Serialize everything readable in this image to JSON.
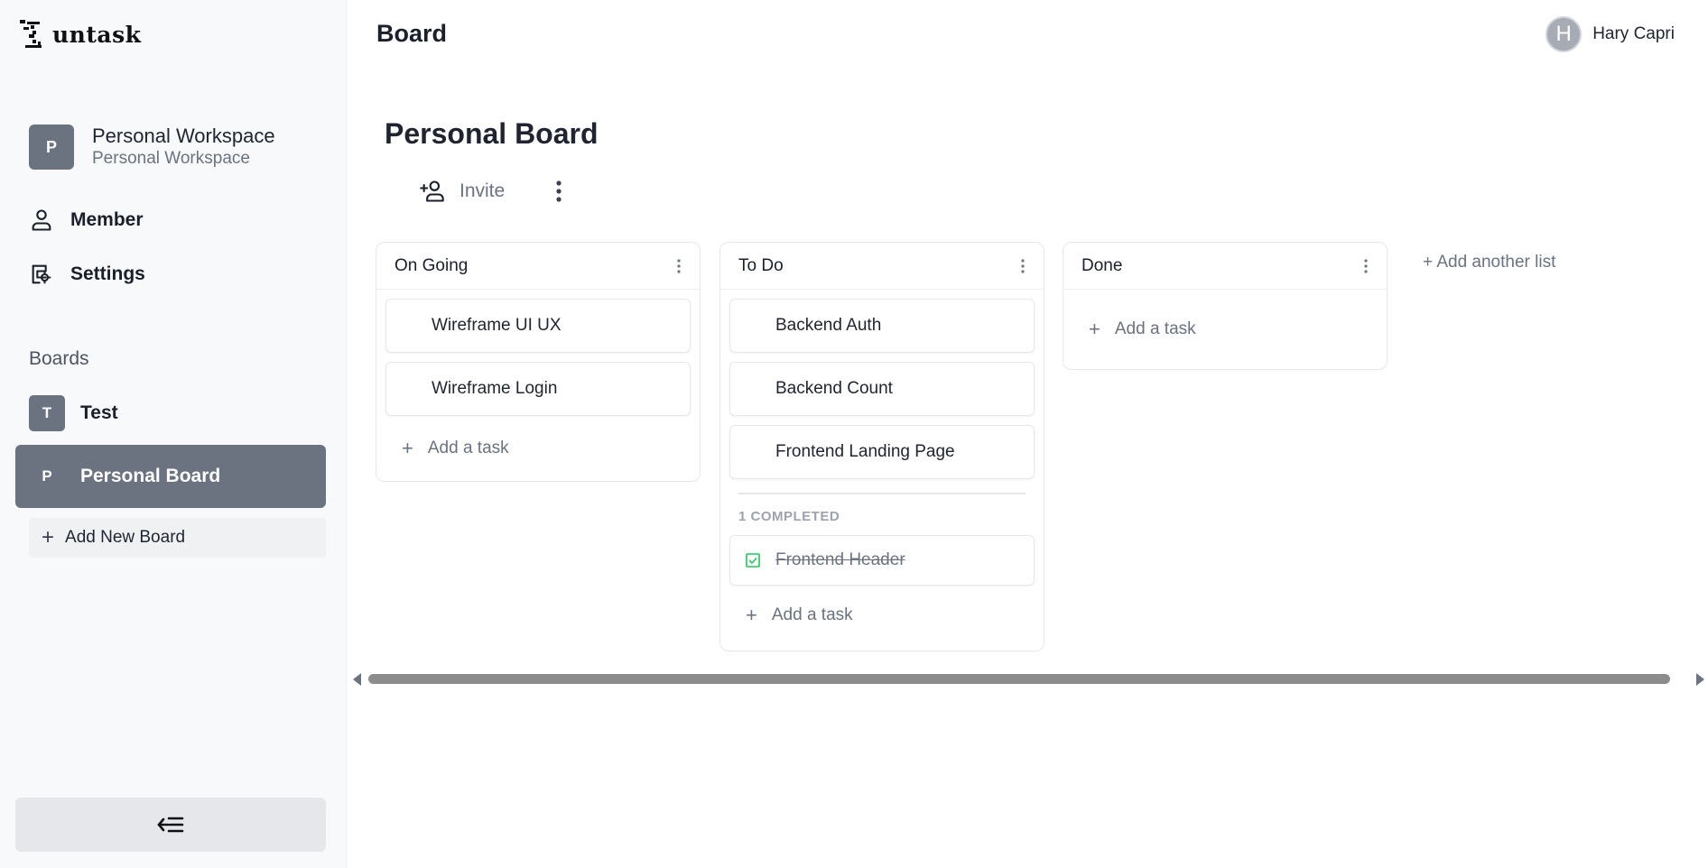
{
  "app": {
    "logo_text": "untask"
  },
  "workspace": {
    "avatar_letter": "P",
    "name": "Personal Workspace",
    "subtitle": "Personal Workspace"
  },
  "nav": {
    "member": "Member",
    "settings": "Settings"
  },
  "boards_section": {
    "label": "Boards",
    "items": [
      {
        "letter": "T",
        "label": "Test",
        "active": false
      },
      {
        "letter": "P",
        "label": "Personal Board",
        "active": true
      }
    ],
    "add_label": "Add New Board"
  },
  "header": {
    "title": "Board",
    "user_initial": "H",
    "user_name": "Hary Capri"
  },
  "board": {
    "title": "Personal Board",
    "invite_label": "Invite"
  },
  "lists": [
    {
      "title": "On Going",
      "tasks": [
        "Wireframe UI UX",
        "Wireframe Login"
      ],
      "add_task": "Add a task"
    },
    {
      "title": "To Do",
      "tasks": [
        "Backend Auth",
        "Backend Count",
        "Frontend Landing Page"
      ],
      "completed_label": "1 COMPLETED",
      "completed_tasks": [
        "Frontend Header"
      ],
      "add_task": "Add a task"
    },
    {
      "title": "Done",
      "tasks": [],
      "add_task": "Add a task"
    }
  ],
  "add_list_label": "+ Add another list",
  "colors": {
    "sidebar_bg": "#f8f9fa",
    "active_board": "#6b7280",
    "check_green": "#22c55e"
  }
}
